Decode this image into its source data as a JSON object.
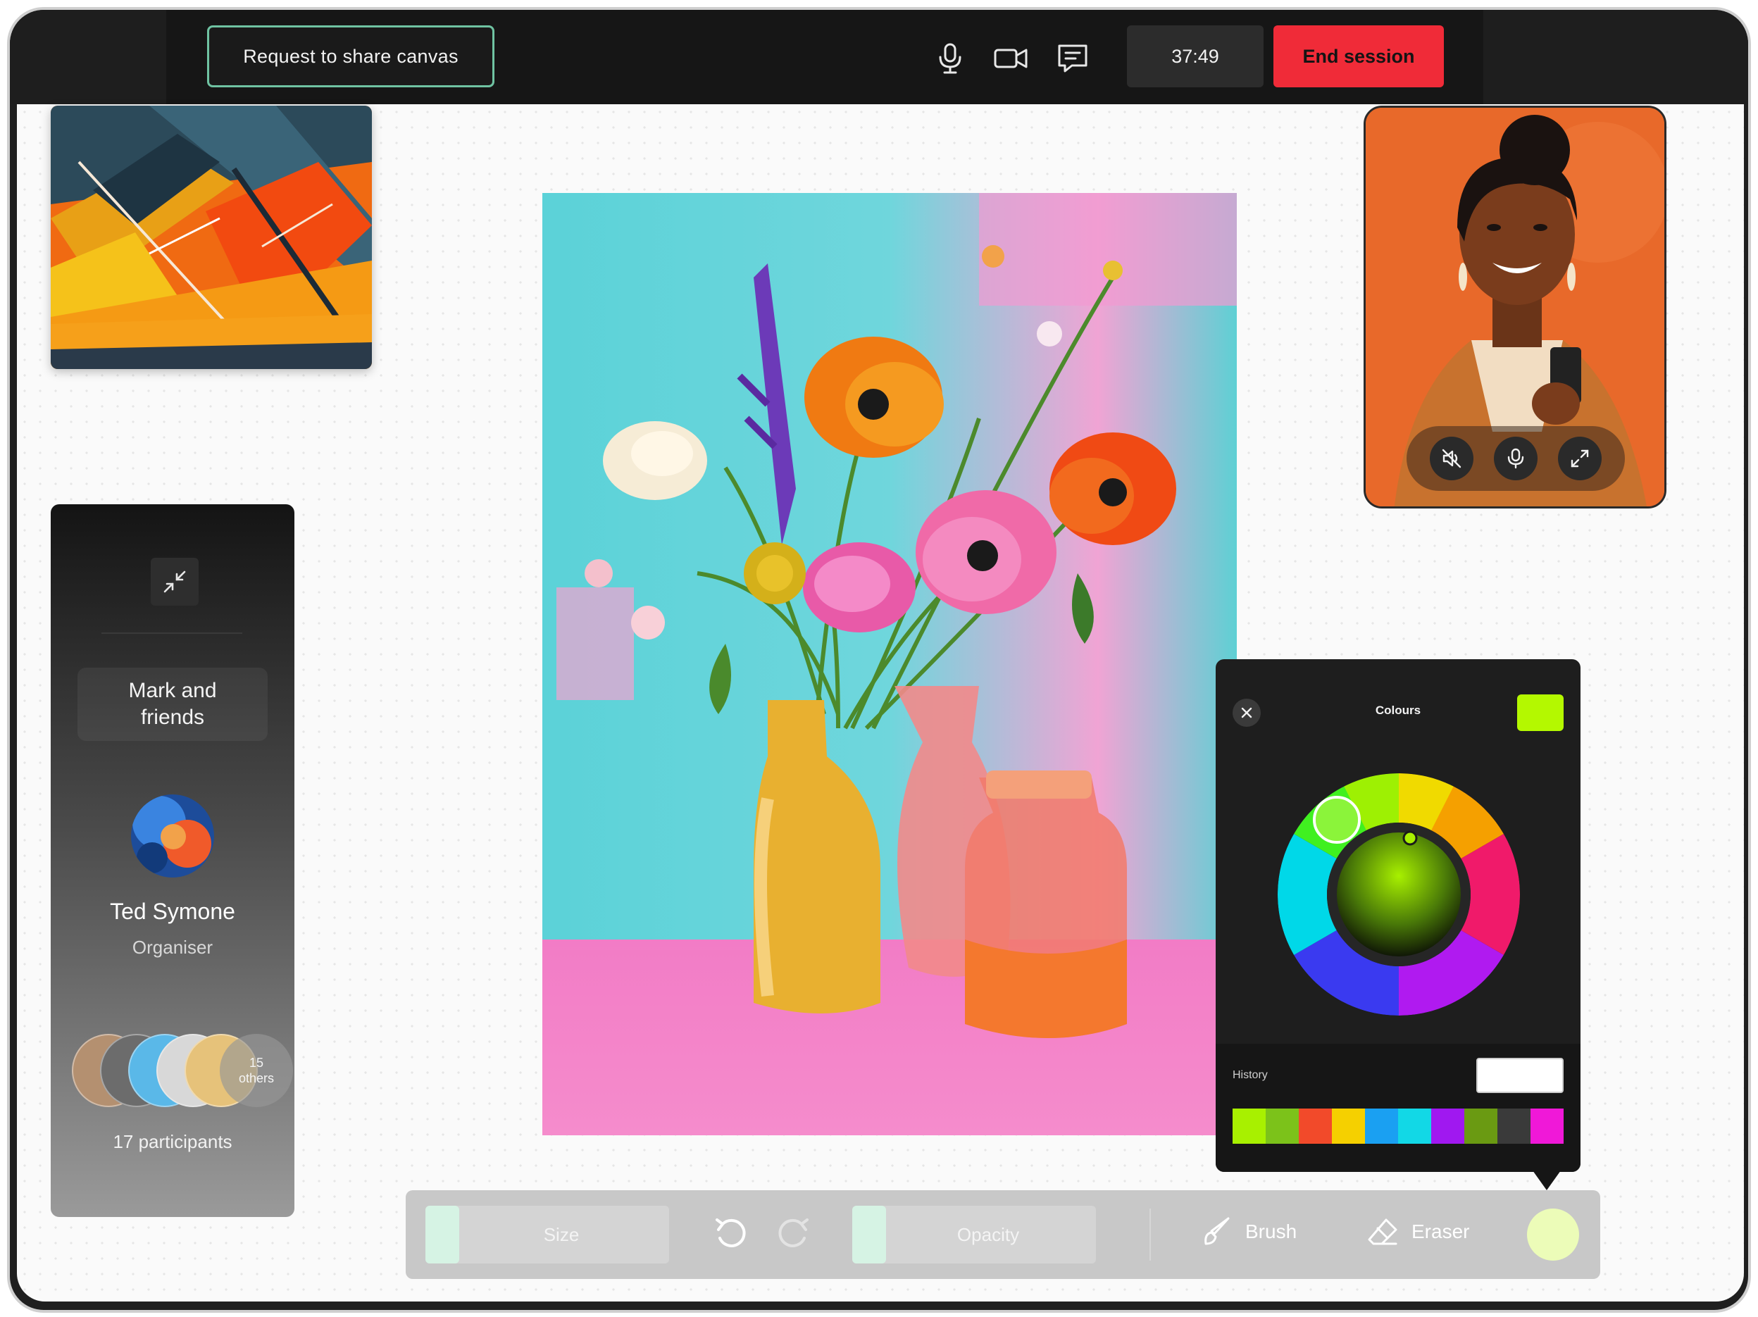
{
  "topbar": {
    "share_label": "Request to share canvas",
    "icons": [
      "microphone-icon",
      "video-camera-icon",
      "chat-icon"
    ],
    "timer": "37:49",
    "end_label": "End session"
  },
  "reference": {
    "name": "reference-image"
  },
  "video": {
    "controls": [
      "mute-speaker-icon",
      "microphone-icon",
      "expand-icon"
    ]
  },
  "sidebar": {
    "group_name": "Mark and friends",
    "organiser_name": "Ted Symone",
    "organiser_role": "Organiser",
    "others_count": "15",
    "others_label": "others",
    "participants": "17 participants"
  },
  "colours": {
    "title": "Colours",
    "current": "#b4f800",
    "history_label": "History",
    "history": [
      "#a8f000",
      "#7cc21a",
      "#f24a2a",
      "#f5d000",
      "#1aa0f2",
      "#12d8e6",
      "#a018f0",
      "#6a9a12",
      "#3a3a3a",
      "#f018d8"
    ]
  },
  "toolbar": {
    "size_label": "Size",
    "opacity_label": "Opacity",
    "brush_label": "Brush",
    "eraser_label": "Eraser",
    "active_colour": "#ecfcb8"
  }
}
